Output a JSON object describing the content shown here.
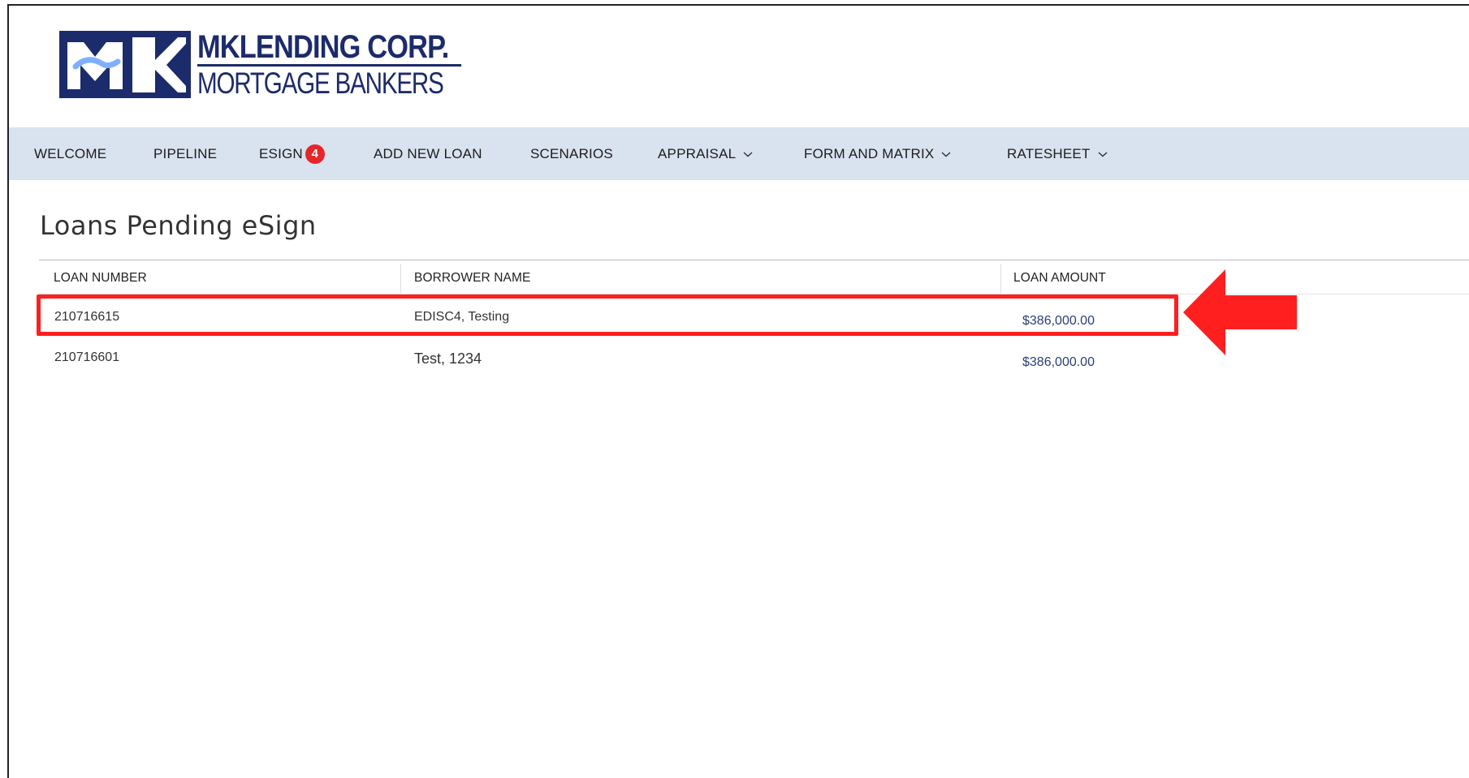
{
  "logo": {
    "line1": "MKLENDING CORP.",
    "line2": "MORTGAGE BANKERS"
  },
  "nav": {
    "items": [
      {
        "label": "WELCOME"
      },
      {
        "label": "PIPELINE"
      },
      {
        "label": "ESIGN",
        "badge": "4"
      },
      {
        "label": "ADD NEW LOAN"
      },
      {
        "label": "SCENARIOS"
      },
      {
        "label": "APPRAISAL",
        "dropdown": true
      },
      {
        "label": "FORM AND MATRIX",
        "dropdown": true
      },
      {
        "label": "RATESHEET",
        "dropdown": true
      }
    ]
  },
  "main": {
    "title": "Loans Pending eSign",
    "table": {
      "headers": [
        "LOAN NUMBER",
        "BORROWER NAME",
        "LOAN AMOUNT"
      ],
      "rows": [
        {
          "loan_number": "210716615",
          "borrower": "EDISC4, Testing",
          "amount": "$386,000.00"
        },
        {
          "loan_number": "210716601",
          "borrower": "Test, 1234",
          "amount": "$386,000.00"
        }
      ]
    }
  },
  "colors": {
    "nav_bg": "#d9e2ef",
    "brand_navy": "#1c2b6b",
    "badge_red": "#e5262a",
    "annotation_red": "#ff1f1f",
    "amount_text": "#2a3e78"
  },
  "icons": {
    "dropdown": "chevron-down-icon",
    "annotation": "red-arrow-left-icon"
  }
}
